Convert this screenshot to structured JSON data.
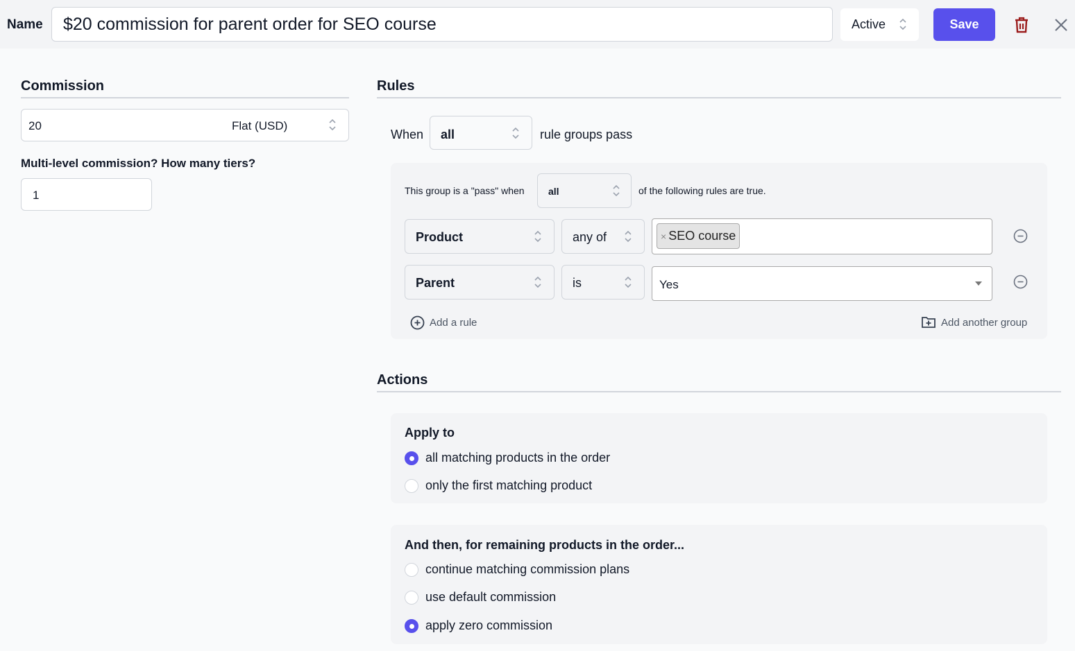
{
  "header": {
    "name_label": "Name",
    "name_value": "$20 commission for parent order for SEO course",
    "status_value": "Active",
    "save_label": "Save",
    "trash_icon": "trash-icon",
    "close_icon": "close-icon"
  },
  "commission": {
    "title": "Commission",
    "amount": "20",
    "type_value": "Flat (USD)",
    "tiers_label": "Multi-level commission? How many tiers?",
    "tiers_value": "1"
  },
  "rules": {
    "title": "Rules",
    "when_label": "When",
    "when_value": "all",
    "when_suffix": "rule groups pass",
    "group": {
      "prefix": "This group is a \"pass\" when",
      "mode_value": "all",
      "suffix": "of the following rules are true.",
      "rows": [
        {
          "field": "Product",
          "operator": "any of",
          "tags": [
            "SEO course"
          ],
          "tag_remove": "×"
        },
        {
          "field": "Parent",
          "operator": "is",
          "value": "Yes"
        }
      ],
      "add_rule_label": "Add a rule",
      "add_group_label": "Add another group"
    }
  },
  "actions": {
    "title": "Actions",
    "apply_to": {
      "title": "Apply to",
      "options": [
        {
          "label": "all matching products in the order",
          "checked": true
        },
        {
          "label": "only the first matching product",
          "checked": false
        }
      ]
    },
    "remaining": {
      "title": "And then, for remaining products in the order...",
      "options": [
        {
          "label": "continue matching commission plans",
          "checked": false
        },
        {
          "label": "use default commission",
          "checked": false
        },
        {
          "label": "apply zero commission",
          "checked": true
        }
      ]
    }
  },
  "colors": {
    "accent": "#5850ec",
    "danger": "#9b1c1c",
    "border": "#d1d5db",
    "panel": "#f3f4f6"
  }
}
